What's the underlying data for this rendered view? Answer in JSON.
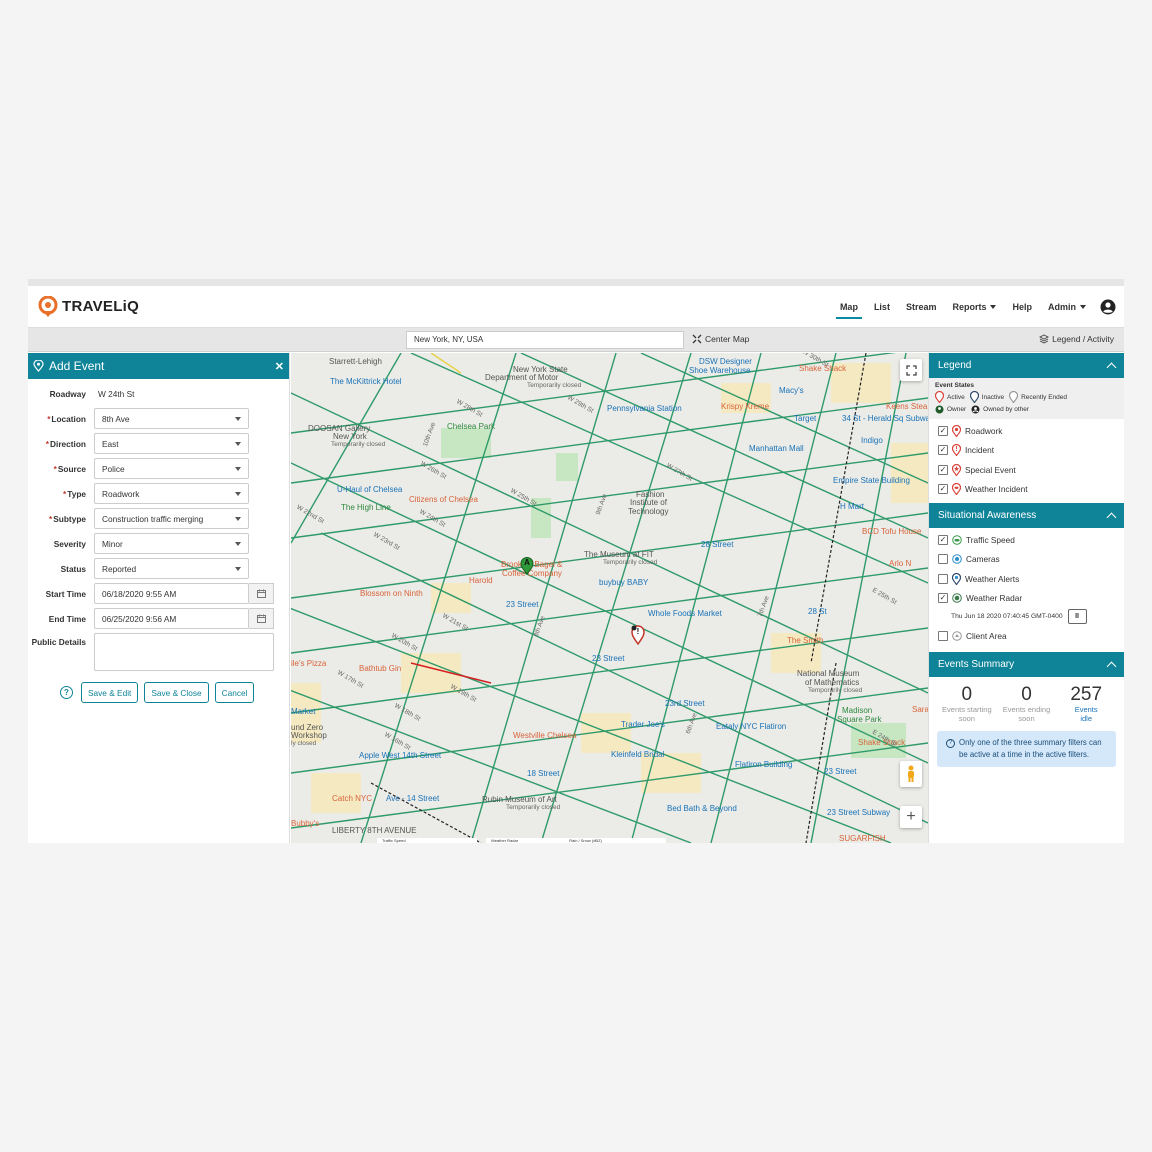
{
  "app": {
    "name": "TRAVELiQ"
  },
  "nav": {
    "items": [
      {
        "label": "Map",
        "active": true
      },
      {
        "label": "List"
      },
      {
        "label": "Stream"
      },
      {
        "label": "Reports"
      },
      {
        "label": "Help"
      },
      {
        "label": "Admin"
      }
    ]
  },
  "toolbar": {
    "search_value": "New York, NY, USA",
    "center_map": "Center Map",
    "legend_activity": "Legend / Activity"
  },
  "add_event": {
    "title": "Add Event",
    "roadway_label": "Roadway",
    "roadway_value": "W 24th St",
    "fields": {
      "location": {
        "label": "Location",
        "value": "8th Ave"
      },
      "direction": {
        "label": "Direction",
        "value": "East"
      },
      "source": {
        "label": "Source",
        "value": "Police"
      },
      "type": {
        "label": "Type",
        "value": "Roadwork"
      },
      "subtype": {
        "label": "Subtype",
        "value": "Construction traffic merging"
      },
      "severity": {
        "label": "Severity",
        "value": "Minor"
      },
      "status": {
        "label": "Status",
        "value": "Reported"
      }
    },
    "start_time": {
      "label": "Start Time",
      "value": "06/18/2020 9:55 AM"
    },
    "end_time": {
      "label": "End Time",
      "value": "06/25/2020 9:56 AM"
    },
    "public_details": {
      "label": "Public Details",
      "value": ""
    },
    "buttons": {
      "save_edit": "Save & Edit",
      "save_close": "Save & Close",
      "cancel": "Cancel"
    }
  },
  "map": {
    "labels": {
      "starrett": "Starrett-Lehigh",
      "mckittrick": "The McKittrick Hotel",
      "doosan": "DOOSAN Gallery",
      "doosan2": "New York",
      "closed1": "Temporarily closed",
      "chelsea_park": "Chelsea Park",
      "uhaul": "U-Haul of Chelsea",
      "highline": "The High Line",
      "citizens": "Citizens of Chelsea",
      "nys_dmv": "New York State",
      "nys_dmv2": "Department of Motor",
      "closed2": "Temporarily closed",
      "dsw": "DSW Designer",
      "dsw2": "Shoe Warehouse",
      "shake_shack": "Shake Shack",
      "macys": "Macy's",
      "penn": "Pennsylvania Station",
      "krispy": "Krispy Kreme",
      "target": "Target",
      "herald": "34 St - Herald Sq Subwa",
      "keens": "Keens Stea",
      "indigo": "Indigo",
      "manhattan_mall": "Manhattan Mall",
      "esb": "Empire State Building",
      "hmart": "H Mart",
      "bcd": "BCD Tofu House",
      "arlo": "Arlo N",
      "fit": "Fashion",
      "fit2": "Institute of",
      "fit3": "Technology",
      "st28": "28 Street",
      "museum_fit": "The Museum at FIT",
      "museum_fit2": "Temporarily closed",
      "brooklyn_bagel": "Brooklyn Bagel &",
      "brooklyn_bagel2": "Coffee Company",
      "harold": "Harold",
      "buybuy": "buybuy BABY",
      "blossom": "Blossom on Ninth",
      "st23a": "23 Street",
      "wholefoods": "Whole Foods Market",
      "st28b": "28 St",
      "smith": "The Smith",
      "st23b": "23 Street",
      "momath": "National Museum",
      "momath2": "of Mathematics",
      "momath3": "Temporarily closed",
      "madison": "Madison",
      "madison2": "Square Park",
      "bathtub": "Bathtub Gin",
      "pizza": "ile's Pizza",
      "market": "Market",
      "und_zero": "und Zero",
      "workshop": "Workshop",
      "closed3": "ly closed",
      "westville": "Westville Chelsea",
      "st23rd": "23rd Street",
      "traderjoe": "Trader Joe's",
      "eataly": "Eataly NYC Flatiron",
      "shake_shack2": "Shake Shack",
      "sara": "Sara",
      "applewest": "Apple West 14th Street",
      "kleinfeld": "Kleinfeld Bridal",
      "flatiron": "Flatiron Building",
      "st18": "18 Street",
      "st23c": "23 Street",
      "catch": "Catch NYC",
      "ave14": "Ave - 14 Street",
      "rubin": "Rubin Museum of Art",
      "rubin2": "Temporarily closed",
      "bedbath": "Bed Bath & Beyond",
      "subway23": "23 Street Subway",
      "bubbys": "Bubby's",
      "liberty": "LIBERTY 8TH AVENUE",
      "sugarfish": "SUGARFISH",
      "traffic_speed": "Traffic Speed",
      "weather_radar": "Weather Radar",
      "rain_snow": "Rain / Snow (dBZ)"
    },
    "streets": [
      "W 30th St",
      "W 29th St",
      "W 28th St",
      "W 27th St",
      "W 26th St",
      "W 25th St",
      "W 24th St",
      "W 23rd St",
      "W 22nd St",
      "W 21st St",
      "W 20th St",
      "W 19th St",
      "W 18th St",
      "W 17th St",
      "W 16th St",
      "10th Ave",
      "9th Ave",
      "8th Ave",
      "7th Ave",
      "6th Ave",
      "E 25th St",
      "E 24th St"
    ],
    "marker_a": "A",
    "marker_b": "!"
  },
  "legend": {
    "title": "Legend",
    "event_states_title": "Event States",
    "states": [
      "Active",
      "Inactive",
      "Recently Ended"
    ],
    "owners": [
      "Owner",
      "Owned by other"
    ],
    "items": [
      {
        "label": "Roadwork",
        "checked": true,
        "color": "#d9433a"
      },
      {
        "label": "Incident",
        "checked": true,
        "color": "#d9433a"
      },
      {
        "label": "Special Event",
        "checked": true,
        "color": "#d9433a"
      },
      {
        "label": "Weather Incident",
        "checked": true,
        "color": "#d9433a"
      }
    ]
  },
  "situational": {
    "title": "Situational Awareness",
    "items": [
      {
        "label": "Traffic Speed",
        "checked": true,
        "color": "#3a9a4a"
      },
      {
        "label": "Cameras",
        "checked": false,
        "color": "#2a8ec9"
      },
      {
        "label": "Weather Alerts",
        "checked": false,
        "color": "#555"
      },
      {
        "label": "Weather Radar",
        "checked": true,
        "color": "#3a9a4a"
      }
    ],
    "radar_timestamp": "Thu Jun 18 2020 07:40:45 GMT-0400",
    "pause_glyph": "II",
    "client_area": {
      "label": "Client Area",
      "checked": false
    }
  },
  "events_summary": {
    "title": "Events Summary",
    "cols": [
      {
        "value": "0",
        "label1": "Events starting",
        "label2": "soon"
      },
      {
        "value": "0",
        "label1": "Events ending",
        "label2": "soon"
      },
      {
        "value": "257",
        "label1": "Events",
        "label2": "idle"
      }
    ],
    "note": "Only one of the three summary filters can be active at a time in the active filters."
  },
  "colors": {
    "accent": "#0f8498",
    "road_green": "#2f9a6a",
    "map_bg": "#ebebe7",
    "park": "#c7e6c2"
  }
}
